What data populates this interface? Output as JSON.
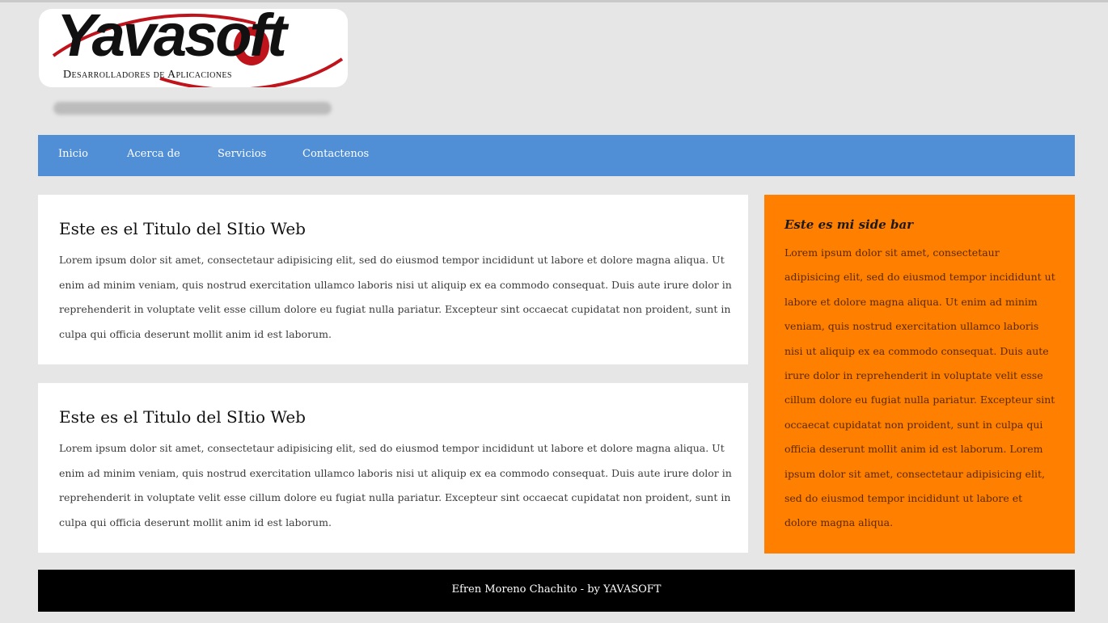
{
  "header": {
    "logo_text": "Yavasoft",
    "logo_subtitle": "Desarrolladores de Aplicaciones"
  },
  "nav": {
    "items": [
      {
        "label": "Inicio"
      },
      {
        "label": "Acerca de"
      },
      {
        "label": "Servicios"
      },
      {
        "label": "Contactenos"
      }
    ]
  },
  "articles": [
    {
      "title": "Este es el Titulo del SItio Web",
      "text": "Lorem ipsum dolor sit amet, consectetaur adipisicing elit, sed do eiusmod tempor incididunt ut labore et dolore magna aliqua. Ut enim ad minim veniam, quis nostrud exercitation ullamco laboris nisi ut aliquip ex ea commodo consequat. Duis aute irure dolor in reprehenderit in voluptate velit esse cillum dolore eu fugiat nulla pariatur. Excepteur sint occaecat cupidatat non proident, sunt in culpa qui officia deserunt mollit anim id est laborum."
    },
    {
      "title": "Este es el Titulo del SItio Web",
      "text": "Lorem ipsum dolor sit amet, consectetaur adipisicing elit, sed do eiusmod tempor incididunt ut labore et dolore magna aliqua. Ut enim ad minim veniam, quis nostrud exercitation ullamco laboris nisi ut aliquip ex ea commodo consequat. Duis aute irure dolor in reprehenderit in voluptate velit esse cillum dolore eu fugiat nulla pariatur. Excepteur sint occaecat cupidatat non proident, sunt in culpa qui officia deserunt mollit anim id est laborum."
    }
  ],
  "sidebar": {
    "title": "Este es mi side bar",
    "text": "Lorem ipsum dolor sit amet, consectetaur adipisicing elit, sed do eiusmod tempor incididunt ut labore et dolore magna aliqua. Ut enim ad minim veniam, quis nostrud exercitation ullamco laboris nisi ut aliquip ex ea commodo consequat. Duis aute irure dolor in reprehenderit in voluptate velit esse cillum dolore eu fugiat nulla pariatur. Excepteur sint occaecat cupidatat non proident, sunt in culpa qui officia deserunt mollit anim id est laborum. Lorem ipsum dolor sit amet, consectetaur adipisicing elit, sed do eiusmod tempor incididunt ut labore et dolore magna aliqua."
  },
  "footer": {
    "text": "Efren Moreno Chachito - by YAVASOFT"
  },
  "colors": {
    "page_background": "#e6e6e6",
    "nav": "#508fd6",
    "sidebar": "#ff7f00",
    "footer": "#000000",
    "logo_accent": "#c0141c"
  }
}
